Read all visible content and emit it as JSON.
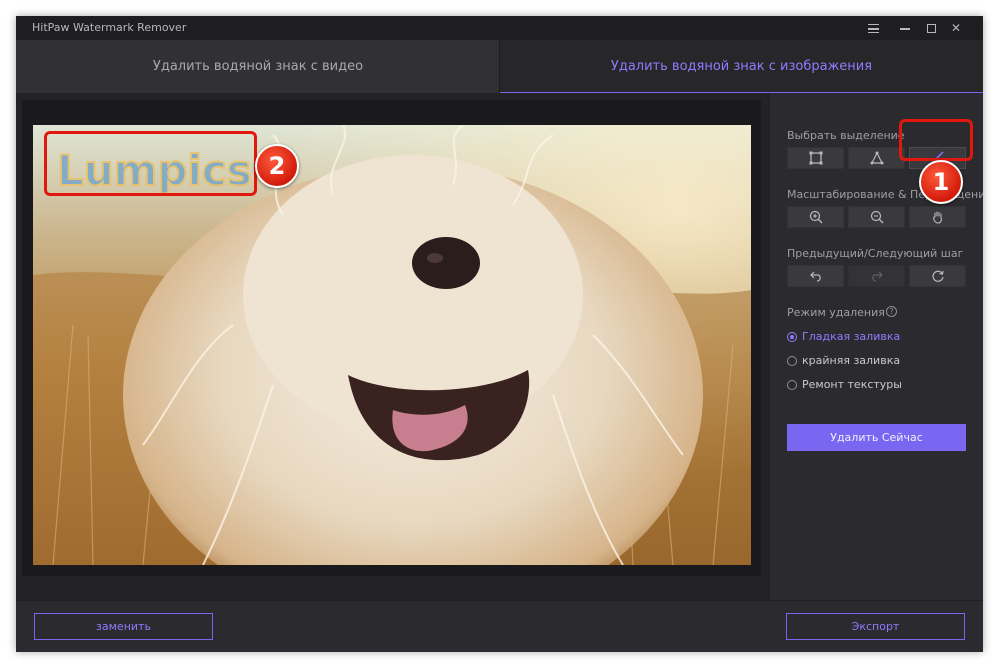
{
  "window": {
    "title": "HitPaw Watermark Remover"
  },
  "tabs": {
    "video": "Удалить водяной знак с видео",
    "image": "Удалить водяной знак с изображения"
  },
  "panel": {
    "select_label": "Выбрать выделение",
    "zoom_label": "Масштабирование & Перемещение",
    "steps_label": "Предыдущий/Следующий шаг",
    "mode_label": "Режим удаления",
    "modes": [
      {
        "label": "Гладкая заливка",
        "checked": true
      },
      {
        "label": "крайняя заливка",
        "checked": false
      },
      {
        "label": "Ремонт текстуры",
        "checked": false
      }
    ],
    "remove_button": "Удалить Сейчас"
  },
  "bottom": {
    "replace_button": "заменить",
    "export_button": "Экспорт"
  },
  "image": {
    "watermark_text": "Lumpics"
  },
  "annotations": {
    "badge_1": "1",
    "badge_2": "2"
  },
  "colors": {
    "accent": "#7966f1",
    "annotation_red": "#e0180d",
    "background": "#2b2b2f"
  },
  "icons": [
    "menu-icon",
    "minimize-icon",
    "maximize-icon",
    "close-icon",
    "rectangle-select-icon",
    "polygon-select-icon",
    "brush-icon",
    "zoom-in-icon",
    "zoom-out-icon",
    "hand-icon",
    "undo-icon",
    "redo-icon",
    "reset-icon",
    "help-icon"
  ]
}
